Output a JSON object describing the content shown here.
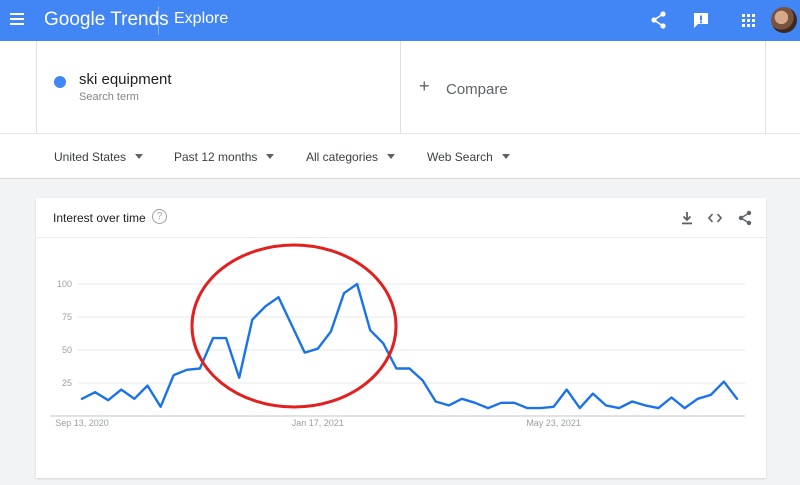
{
  "header": {
    "logo_google": "Google",
    "logo_trends": "Trends",
    "page_title": "Explore",
    "icons": [
      "menu-icon",
      "share-icon",
      "feedback-icon",
      "apps-icon",
      "avatar"
    ],
    "color": "#4285f4"
  },
  "search": {
    "term": "ski equipment",
    "term_sublabel": "Search term",
    "term_color": "#4285f4",
    "compare_label": "Compare"
  },
  "filters": {
    "region": "United States",
    "period": "Past 12 months",
    "category": "All categories",
    "property": "Web Search"
  },
  "card": {
    "title": "Interest over time",
    "help": "?",
    "icons": [
      "download-icon",
      "embed-icon",
      "share-icon"
    ]
  },
  "annotation": {
    "shape": "ellipse",
    "color": "#e32020"
  },
  "chart_data": {
    "type": "line",
    "ylim": [
      0,
      100
    ],
    "yticks": [
      "25",
      "50",
      "75",
      "100"
    ],
    "xtick_labels": [
      "Sep 13, 2020",
      "Jan 17, 2021",
      "May 23, 2021"
    ],
    "xtick_index": [
      0,
      18,
      36
    ],
    "grid": true,
    "series": [
      {
        "color": "#1a73e8",
        "values": [
          13,
          18,
          12,
          20,
          13,
          23,
          7,
          31,
          35,
          36,
          59,
          59,
          29,
          73,
          83,
          90,
          69,
          48,
          51,
          64,
          93,
          100,
          65,
          55,
          36,
          36,
          27,
          11,
          8,
          13,
          10,
          6,
          10,
          10,
          6,
          6,
          7,
          20,
          6,
          17,
          8,
          6,
          11,
          8,
          6,
          14,
          6,
          13,
          16,
          26,
          13
        ]
      }
    ]
  }
}
